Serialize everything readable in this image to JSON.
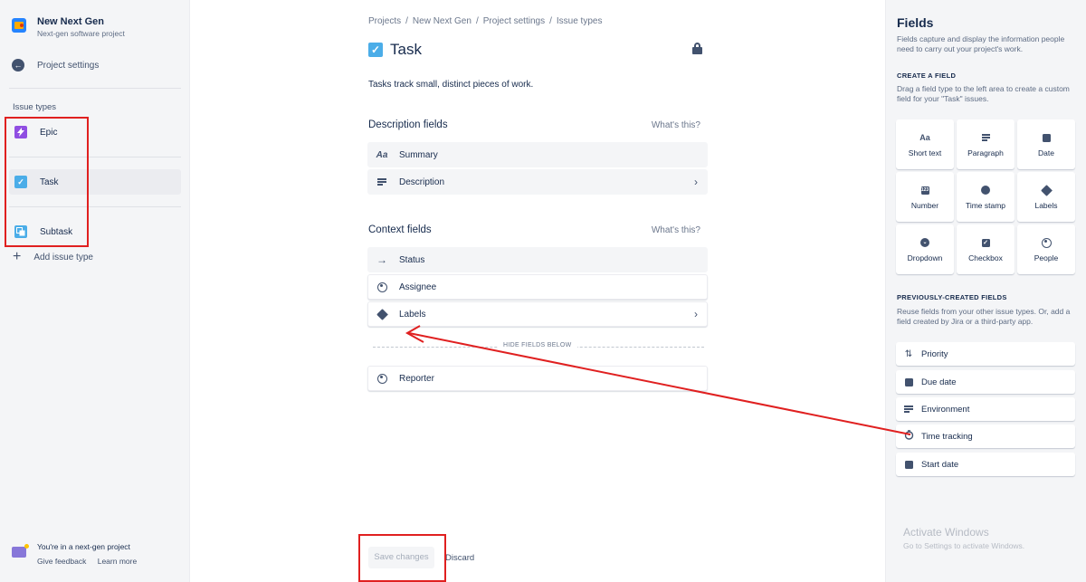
{
  "project": {
    "name": "New Next Gen",
    "subtitle": "Next-gen software project"
  },
  "back_label": "Project settings",
  "issue_types": {
    "heading": "Issue types",
    "items": [
      {
        "label": "Epic",
        "icon": "lightning-icon",
        "color": "#904ee2"
      },
      {
        "label": "Task",
        "icon": "checkbox-icon",
        "color": "#4bade8"
      },
      {
        "label": "Subtask",
        "icon": "subtask-icon",
        "color": "#4bade8"
      }
    ],
    "add_label": "Add issue type"
  },
  "footer": {
    "note": "You're in a next-gen project",
    "feedback": "Give feedback",
    "learn": "Learn more"
  },
  "breadcrumb": [
    "Projects",
    "New Next Gen",
    "Project settings",
    "Issue types"
  ],
  "issue": {
    "title": "Task",
    "description": "Tasks track small, distinct pieces of work."
  },
  "description_fields": {
    "title": "Description fields",
    "whats_this": "What's this?",
    "items": [
      {
        "label": "Summary",
        "icon": "Aa"
      },
      {
        "label": "Description",
        "icon": "paragraph-icon"
      }
    ]
  },
  "context_fields": {
    "title": "Context fields",
    "whats_this": "What's this?",
    "items": [
      {
        "label": "Status",
        "icon": "→"
      },
      {
        "label": "Assignee",
        "icon": "person-icon"
      },
      {
        "label": "Labels",
        "icon": "tag-icon"
      }
    ],
    "hide_label": "HIDE FIELDS BELOW",
    "hidden": [
      {
        "label": "Reporter",
        "icon": "person-icon"
      }
    ]
  },
  "actions": {
    "save": "Save changes",
    "discard": "Discard"
  },
  "fields_panel": {
    "title": "Fields",
    "intro": "Fields capture and display the information people need to carry out your project's work.",
    "create_heading": "CREATE A FIELD",
    "create_help": "Drag a field type to the left area to create a custom field for your \"Task\" issues.",
    "tiles": [
      {
        "label": "Short text",
        "glyph": "Aa"
      },
      {
        "label": "Paragraph",
        "glyph": "≡"
      },
      {
        "label": "Date",
        "glyph": "▦"
      },
      {
        "label": "Number",
        "glyph": "123"
      },
      {
        "label": "Time stamp",
        "glyph": "◷"
      },
      {
        "label": "Labels",
        "glyph": "◆"
      },
      {
        "label": "Dropdown",
        "glyph": "⌄"
      },
      {
        "label": "Checkbox",
        "glyph": "✓"
      },
      {
        "label": "People",
        "glyph": "●"
      }
    ],
    "prev_heading": "PREVIOUSLY-CREATED FIELDS",
    "prev_help": "Reuse fields from your other issue types. Or, add a field created by Jira or a third-party app.",
    "prev_items": [
      {
        "label": "Priority",
        "glyph": "⇅"
      },
      {
        "label": "Due date",
        "glyph": "▦"
      },
      {
        "label": "Environment",
        "glyph": "≡"
      },
      {
        "label": "Time tracking",
        "glyph": "◔"
      },
      {
        "label": "Start date",
        "glyph": "▦"
      }
    ]
  },
  "watermark": {
    "line1": "Activate Windows",
    "line2": "Go to Settings to activate Windows."
  },
  "annotation_color": "#e02020"
}
